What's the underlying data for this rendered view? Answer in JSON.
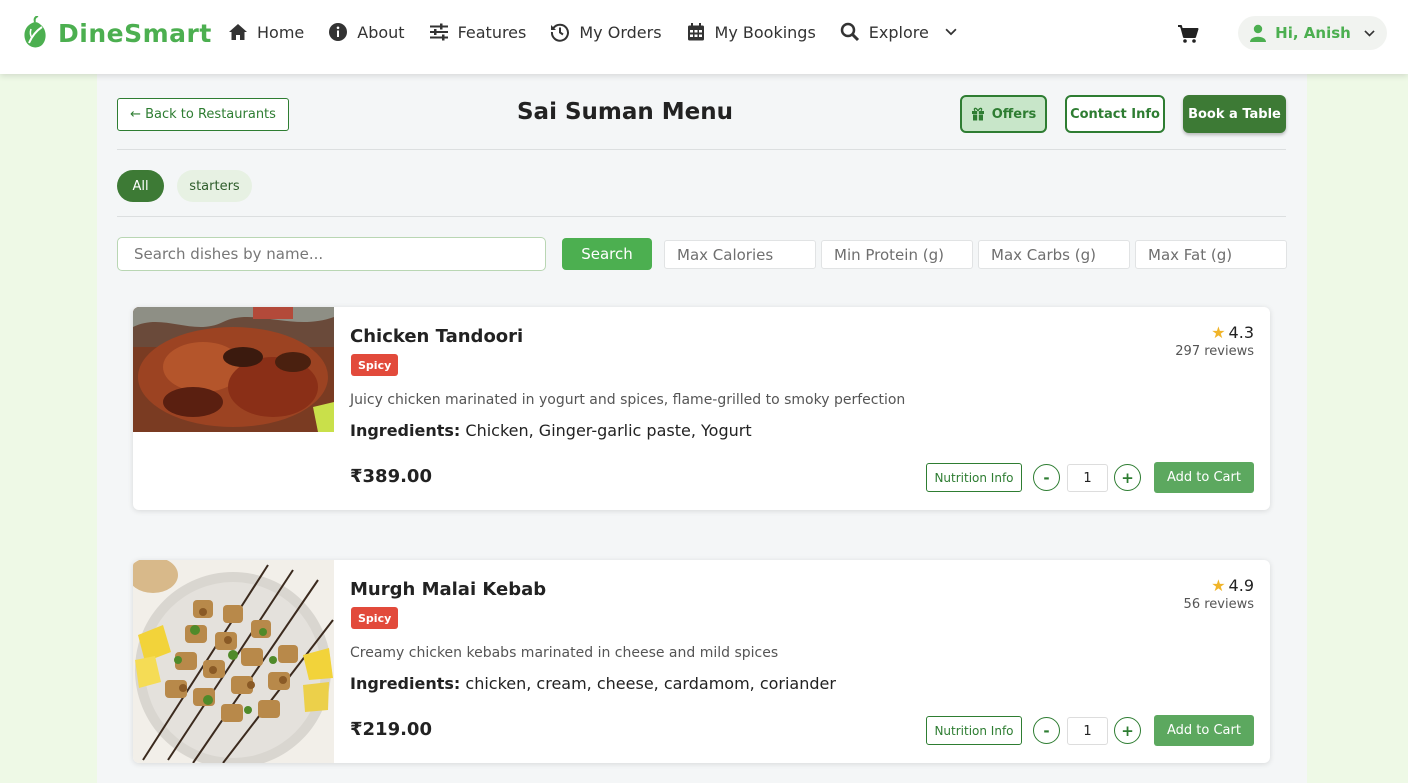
{
  "brand": {
    "name": "DineSmart",
    "color": "#4caf50"
  },
  "nav": {
    "items": [
      {
        "label": "Home",
        "icon": "home-icon"
      },
      {
        "label": "About",
        "icon": "info-icon"
      },
      {
        "label": "Features",
        "icon": "sliders-icon"
      },
      {
        "label": "My Orders",
        "icon": "history-icon"
      },
      {
        "label": "My Bookings",
        "icon": "calendar-icon"
      },
      {
        "label": "Explore",
        "icon": "search-icon"
      }
    ],
    "cart_icon": "cart-icon",
    "user_greeting": "Hi, Anish"
  },
  "header": {
    "back_label": "← Back to Restaurants",
    "title": "Sai Suman Menu",
    "offers_label": "Offers",
    "contact_label": "Contact Info",
    "book_label": "Book a Table"
  },
  "categories": [
    {
      "label": "All",
      "active": true
    },
    {
      "label": "starters",
      "active": false
    }
  ],
  "search": {
    "placeholder": "Search dishes by name...",
    "button_label": "Search"
  },
  "filters": [
    {
      "placeholder": "Max Calories"
    },
    {
      "placeholder": "Min Protein (g)"
    },
    {
      "placeholder": "Max Carbs (g)"
    },
    {
      "placeholder": "Max Fat (g)"
    }
  ],
  "dishes": [
    {
      "name": "Chicken Tandoori",
      "badge": "Spicy",
      "description": "Juicy chicken marinated in yogurt and spices, flame-grilled to smoky perfection",
      "ingredients_label": "Ingredients:",
      "ingredients": "Chicken, Ginger-garlic paste, Yogurt",
      "price": "₹389.00",
      "rating": "4.3",
      "reviews": "297 reviews",
      "quantity": "1",
      "nutrition_label": "Nutrition Info",
      "add_label": "Add to Cart"
    },
    {
      "name": "Murgh Malai Kebab",
      "badge": "Spicy",
      "description": "Creamy chicken kebabs marinated in cheese and mild spices",
      "ingredients_label": "Ingredients:",
      "ingredients": "chicken, cream, cheese, cardamom, coriander",
      "price": "₹219.00",
      "rating": "4.9",
      "reviews": "56 reviews",
      "quantity": "1",
      "nutrition_label": "Nutrition Info",
      "add_label": "Add to Cart"
    }
  ],
  "colors": {
    "primary": "#4caf50",
    "dark_green": "#2e7d32",
    "badge_red": "#e24a3b",
    "star": "#f0b429"
  }
}
